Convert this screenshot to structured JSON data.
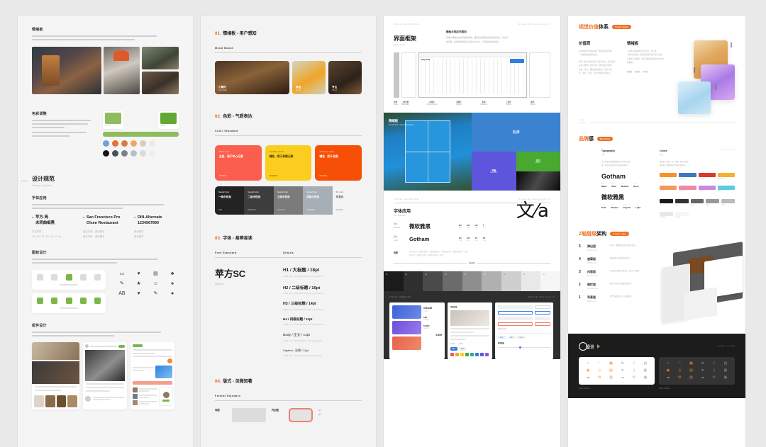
{
  "meta": {
    "background": "#e9e9ea",
    "accent": "#ef7122",
    "accent_red": "#f06450",
    "accent_green": "#7ab648"
  },
  "panel1": {
    "mood": {
      "title": "情绪板",
      "body": [
        "营造温暖的生活氛围，让用户产生强烈的认同感，",
        "呈现细腻的生活方式美学的视觉表现"
      ]
    },
    "color": {
      "title": "色彩调整",
      "body": [
        "我们的主色调体现了温暖和活力，辅色和冷静的色彩形成视觉平衡。",
        "配合灰度，提升和中性的质感，提升了视觉感，让用户阅读更放松且自然舒适，不显色疲劳。",
        "同时，我们增加了一部分辅助色彩，在交互中细微的变化上提供更多层级感和清晰的功能性表达。"
      ],
      "chipA": "#8fbc5e",
      "chipB": "#63a832",
      "bar": "#8fbc5e",
      "dots_row1": [
        "#6fa3d8",
        "#e8722b",
        "#d97a3e",
        "#f0a860",
        "#dccbb8",
        "#efeae2"
      ],
      "dots_row2": [
        "#151515",
        "#4a5059",
        "#7b8089",
        "#b9bec4",
        "#d8dbdd",
        "#eceeef"
      ]
    },
    "design_system": {
      "title": "设计规范",
      "subtitle": "Design System",
      "font_section_label": "字体应用",
      "font_section_body": [
        "中英文混合排版使用同一分级表，确保字号和行高之间保持视觉节奏，",
        "以少量字体层级传达主次信息关系。"
      ],
      "fonts": [
        {
          "name_line1": "苹方-简",
          "name_line2": "未转曲细黑",
          "meta1": "中文字体",
          "meta2": "24 / 20 / 18 / 16 / 14 / 12 pt"
        },
        {
          "name_line1": "San Francisco Pro",
          "name_line2": "Olsen Restaurant",
          "meta1": "西文字体、部分数字",
          "meta2": "西文字体、部分数字"
        },
        {
          "name_line1": "DIN-Alternate",
          "name_line2": "1234567890",
          "meta1": "部分数字",
          "meta2": "部分数字"
        }
      ],
      "icon_section_label": "图标设计",
      "icon_section_body": [
        "图标系统基于了线性描边设计，保持统一的笔画、圆角、转角半径，",
        "并确保在不同尺寸下显示清晰，适合多种屏幕尺寸使用。"
      ],
      "glyphs": [
        "▭",
        "♥",
        "▤",
        "♣",
        "✎",
        "★",
        "☺",
        "♠",
        "AB",
        "♥",
        "✎",
        "●"
      ]
    },
    "component": {
      "title": "组件设计",
      "body": [
        "组件库遵循了可复用的设计原则，保持各类组件在统一、直观、一致下",
        "具备良好的视觉表达和了层次，让交互更易用于识别。"
      ]
    }
  },
  "panel2": {
    "sections": [
      {
        "num": "01.",
        "cn": "情绪板 - 用户感知",
        "label": "Mood Board"
      },
      {
        "num": "02.",
        "cn": "色彩 - 气质表达",
        "label": "Color Standard"
      },
      {
        "num": "03.",
        "cn": "字体 - 易辨易读",
        "label": "Font Standard"
      },
      {
        "num": "04.",
        "cn": "版式 - 见微知著",
        "label": "Format Standard"
      }
    ],
    "moods": [
      {
        "cn": "小聚时",
        "en": "Friendship",
        "color": "#6a4a30"
      },
      {
        "cn": "鲜活",
        "en": "Fresh",
        "color": "#e0a03a"
      },
      {
        "cn": "专注",
        "en": "Focus",
        "color": "#5c4532"
      }
    ],
    "colors": [
      {
        "tag": "Main Color",
        "name": "主色 - 用于中心元素",
        "hex": "#FF5E4F",
        "bg": "#fb5e4e",
        "fg": "#ffffff"
      },
      {
        "tag": "Auxiliary Color",
        "name": "辅色 - 用于承载元素",
        "hex": "#FDCE1D",
        "bg": "#fbcd1f",
        "fg": "#3a3000"
      },
      {
        "tag": "Auxiliary Color",
        "name": "辅色 - 用于点缀",
        "hex": "#FA4E02",
        "bg": "#f74f06",
        "fg": "#ffffff"
      }
    ],
    "neutrals": [
      {
        "tag": "Neutral Color",
        "name": "一级中性色",
        "hex": "#111",
        "bg": "#232323",
        "fg": "#ffffff"
      },
      {
        "tag": "Neutral Color",
        "name": "二级中性色",
        "hex": "#3C3C3C",
        "bg": "#3d3d3d",
        "fg": "#ffffff"
      },
      {
        "tag": "Neutral Color",
        "name": "三级中性色",
        "hex": "#7A7A7A",
        "bg": "#7b7b7b",
        "fg": "#ffffff"
      },
      {
        "tag": "Neutral Color",
        "name": "四级中性色",
        "hex": "#A8B0B8",
        "bg": "#a6aeb6",
        "fg": "#ffffff"
      },
      {
        "tag": "BG Color",
        "name": "背景色",
        "hex": "#F5F5F5",
        "bg": "#f4f4f4",
        "fg": "#6d6d6d"
      }
    ],
    "font_standard": {
      "family": "苹方SC",
      "family_note": "简体中文",
      "details_label": "Details",
      "items": [
        {
          "title": "H1 / 大标题 / 18pt",
          "meta": "LINE 26  |  TRACKING 0.00  |  Semibold",
          "size": 6.4
        },
        {
          "title": "H2 / 二级标题 / 16pt",
          "meta": "LINE 22  |  TRACKING 0.00  |  Semibold",
          "size": 5.8
        },
        {
          "title": "H3 / 三级标题 / 14pt",
          "meta": "LINE 20  |  TRACKING 0.00  |  Semibold",
          "size": 5.2
        },
        {
          "title": "H4 / 四级标题 / 12pt",
          "meta": "LINE 17  |  TRACKING 0.00  |  Semibold",
          "size": 4.6
        },
        {
          "title": "Body / 正文 / 14pt",
          "meta": "LINE 22  |  TRACKING 0.00  |  Regular",
          "size": 4.8
        },
        {
          "title": "Caption / 注释 / 11pt",
          "meta": "LINE 15  |  TRACKING 0.00  |  Regular",
          "size": 4.0
        }
      ]
    },
    "format": {
      "outer_label": "间距",
      "inner_label": "内边距",
      "options": [
        "4pt",
        "8pt",
        "12pt"
      ]
    }
  },
  "panel3": {
    "header": {
      "left": "VISUAL GUIDELINE",
      "right": "Design By Experience.UI"
    },
    "layout": {
      "title": "界面框架",
      "subtitle": "Page Layout",
      "desc_title": "栅格与响应式规则",
      "desc": [
        "采用12栅格流式布局规则编排，栅格区宽度保持通栏响应列宽，列之间",
        "的间距，内容区域宽度最大值为1200px，于适配多终端设备。"
      ]
    },
    "wire_caps": [
      {
        "cn": "导航",
        "en": "Menu"
      },
      {
        "cn": "二级导航",
        "en": "Subsidiary"
      },
      {
        "cn": "内容区",
        "en": "CSS+Content"
      },
      {
        "cn": "功能栏",
        "en": "Module"
      },
      {
        "cn": "表格",
        "en": "Cold-axis"
      },
      {
        "cn": "工具栏",
        "en": "Toolbar"
      },
      {
        "cn": "属性",
        "en": "Present"
      }
    ],
    "hero": {
      "label_cn": "情绪板",
      "label_en": "Mood Board - Visual Temperature",
      "blocks": [
        {
          "cn": "活力感",
          "en": "VITALITY",
          "color": "#3b83d0"
        },
        {
          "cn": "平衡",
          "en": "BALANCE",
          "color": "#5e55dd"
        },
        {
          "cn": "活力",
          "en": "ENERGY",
          "color": "#49a830"
        }
      ]
    },
    "font_usage": {
      "header_left": "VISUAL GUIDELINE",
      "header_right": "Design By Experience.UI",
      "title": "字体应用",
      "subtitle": "Font Standard",
      "rows": [
        {
          "tag_cn": "中文",
          "tag_en": "Chinese",
          "name": "微软雅黑",
          "metrics": [
            {
              "k": "H1",
              "v": "18pt"
            },
            {
              "k": "H2",
              "v": "16pt"
            },
            {
              "k": "H3",
              "v": "14pt"
            },
            {
              "k": "T",
              "v": "12pt"
            }
          ]
        },
        {
          "tag_cn": "西文",
          "tag_en": "Latin",
          "name": "Gotham",
          "metrics": [
            {
              "k": "H1",
              "v": "20pt"
            },
            {
              "k": "H2",
              "v": "16pt"
            },
            {
              "k": "T1",
              "v": "14pt"
            },
            {
              "k": "T2",
              "v": "12pt"
            }
          ]
        }
      ],
      "gray_label": "色阶",
      "gray_desc": [
        "灰阶变化了一级黑色使用了一级黑色使用了一级黑色使用了一级黑色使用了一级黑",
        "色使用了一级黑色使用了一级黑色使用了一级黑"
      ],
      "neutral_axis": "Neutral"
    },
    "gray_scale": [
      "#1b1b1b",
      "#2f2f2f",
      "#4a4a4a",
      "#6b6b6b",
      "#8e8e8e",
      "#b0b0b0",
      "#cfcfcf",
      "#e8e8e8",
      "#f6f6f6"
    ],
    "ui": {
      "header_left": "VISUAL GUIDELINE",
      "header_right": "Design By Experience.UI",
      "stats": [
        {
          "label": "总资产金额（元）",
          "value": "¥28,846.81",
          "tint": "#3b62d8"
        },
        {
          "label": "累计收益金额（元）",
          "value": "¥49,882.65",
          "tint": "#6b4fd8"
        },
        {
          "label": "本月支出（元）",
          "value": "¥582.29",
          "tint": "#e8604e"
        }
      ],
      "metrics": [
        {
          "label": "本月收入",
          "value": "¥45,449"
        },
        {
          "label": "新增用户",
          "value": "180"
        },
        {
          "label": "同比增长",
          "value": "5.69%"
        },
        {
          "label": "订单总数",
          "value": "5,659"
        }
      ],
      "swatch_strip": [
        "#e8604e",
        "#f0a72e",
        "#fbcd1f",
        "#49a830",
        "#2fa8a0",
        "#2f7fe0",
        "#5e55dd",
        "#8e55dd"
      ]
    }
  },
  "panel4": {
    "visual_value": {
      "title_hl": "视觉价值",
      "title_rest": "体系",
      "pill": "Visual Value",
      "columns": [
        {
          "h": "价值观",
          "p": [
            "设计规范的价值是构建一套视觉语言的统",
            "一性和高效的团队协作。",
            "",
            "在同一套平台中的设计不是过去记，通过用户",
            "认知习惯和方式的手段，我们把空间的配",
            "色度、层次、细腻的视觉表达，提升对话",
            "度、简洁、层别，带出大的视觉表现力。"
          ]
        },
        {
          "h": "情绪板",
          "p": [
            "正是我们观察到的生活之中，在日常",
            "习惯与的效果，用温度的使得留下提升中的",
            "主要的元素展示，保持清晰思维的层的的的的",
            "经情感。"
          ],
          "tags": [
            "情绪板",
            "视觉化",
            "空间化"
          ]
        }
      ],
      "art_labels": [
        "仪式感",
        "轻量化",
        "沉浸式"
      ]
    },
    "branding": {
      "title_hl": "品牌",
      "title_rest": "感",
      "pill": "Branding",
      "footer_tag": "VISUAL SYSTEM",
      "typo": {
        "h": "Typography",
        "sub": "字体",
        "p": [
          "中文字体选用微软雅黑作为中性的呈现",
          "体，西文优先使用字中化的Gotham。"
        ],
        "rows": [
          {
            "tag": "西文品牌 →",
            "name": "Gotham",
            "metrics": [
              {
                "k": "Black",
                "v": "24pt"
              },
              {
                "k": "Bold",
                "v": "18pt"
              },
              {
                "k": "Medium",
                "v": "14pt"
              },
              {
                "k": "Book",
                "v": "12pt"
              }
            ]
          },
          {
            "tag": "中文 →",
            "name": "微软雅黑",
            "metrics": [
              {
                "k": "Bold",
                "v": "22pt"
              },
              {
                "k": "Medium",
                "v": "18pt"
              },
              {
                "k": "Regular",
                "v": "14pt"
              },
              {
                "k": "Light",
                "v": "12pt"
              }
            ]
          }
        ]
      },
      "colors": {
        "h": "Colors",
        "sub": "色彩",
        "p": [
          "整体是「温和」和「沉静」两个色调的",
          "本体的一套更和有活力的色彩体系。"
        ],
        "row1": [
          {
            "hex": "#F7902D",
            "bg": "#f7902d"
          },
          {
            "hex": "#3D79BF",
            "bg": "#3d79bf"
          },
          {
            "hex": "#D93A2B",
            "bg": "#d93a2b"
          },
          {
            "hex": "#F5B12E",
            "bg": "#f5b12e"
          }
        ],
        "row2": [
          {
            "hex": "#F5985C",
            "bg": "#f5985c"
          },
          {
            "hex": "#ED8AA6",
            "bg": "#ed8aa6"
          },
          {
            "hex": "#C88ADC",
            "bg": "#c88adc"
          },
          {
            "hex": "#5ACBE0",
            "bg": "#5acbe0"
          }
        ],
        "grays": [
          {
            "hex": "#111",
            "bg": "#1a1a1a"
          },
          {
            "hex": "#333",
            "bg": "#333333"
          },
          {
            "hex": "#666",
            "bg": "#666666"
          },
          {
            "hex": "#999",
            "bg": "#999999"
          },
          {
            "hex": "#BBB",
            "bg": "#bbbbbb"
          },
          {
            "hex": "#E8E8E8",
            "bg": "#e8e8e8"
          },
          {
            "hex": "#F6F6F6",
            "bg": "#f6f6f6"
          }
        ]
      }
    },
    "zaxis": {
      "title_hl": "Z轴层级",
      "title_rest": "架构",
      "pill": "Z-Axis Layer",
      "layers": [
        {
          "num": "5",
          "cn": "弹出层",
          "en": "Popup Layer",
          "desc": "Toast、弹窗等突出性质的提示信息。"
        },
        {
          "num": "4",
          "cn": "遮罩层",
          "en": "Partial Layer",
          "desc": "模态遮罩以强调当前的交互。"
        },
        {
          "num": "3",
          "cn": "内容层",
          "en": "Content Layer",
          "desc": "大部分信息展示的区域，包括卡片和表格。"
        },
        {
          "num": "2",
          "cn": "侧栏层",
          "en": "Side Bar Layer",
          "desc": "提供于导航区的辅助性操作区。"
        },
        {
          "num": "1",
          "cn": "背景层",
          "en": "Basic Layer",
          "desc": "整个页面的底层，如页面底色。"
        }
      ]
    },
    "icons": {
      "title": "设计",
      "tag": "VISUAL SYSTEM",
      "light_label": "Light Mode",
      "dark_label": "Dark Mode",
      "glyphs": [
        "🏠",
        "♡",
        "🔒",
        "⚙",
        "▽",
        "🔒",
        "💡",
        "🗒",
        "🧰",
        "⚙",
        "🗒",
        "▦",
        "☁",
        "✉",
        "🧳",
        "☁",
        "✉",
        "🗑"
      ]
    }
  }
}
